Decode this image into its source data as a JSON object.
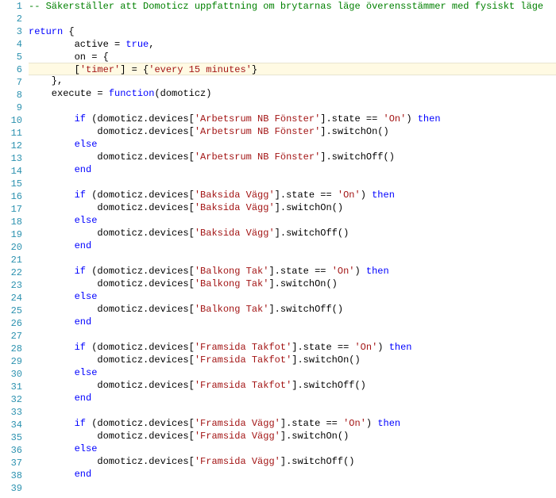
{
  "lines": [
    {
      "num": 1,
      "highlighted": false,
      "tokens": [
        {
          "t": "-- Säkerställer att Domoticz uppfattning om brytarnas läge överensstämmer med fysiskt läge",
          "c": "comment"
        }
      ]
    },
    {
      "num": 2,
      "highlighted": false,
      "tokens": []
    },
    {
      "num": 3,
      "highlighted": false,
      "tokens": [
        {
          "t": "return",
          "c": "keyword"
        },
        {
          "t": " {",
          "c": "punct"
        }
      ]
    },
    {
      "num": 4,
      "highlighted": false,
      "tokens": [
        {
          "t": "        active = ",
          "c": "ident"
        },
        {
          "t": "true",
          "c": "keyword"
        },
        {
          "t": ",",
          "c": "punct"
        }
      ]
    },
    {
      "num": 5,
      "highlighted": false,
      "tokens": [
        {
          "t": "        on = {",
          "c": "ident"
        }
      ]
    },
    {
      "num": 6,
      "highlighted": true,
      "tokens": [
        {
          "t": "        [",
          "c": "punct"
        },
        {
          "t": "'timer'",
          "c": "string"
        },
        {
          "t": "] = {",
          "c": "punct"
        },
        {
          "t": "'every 15 minutes'",
          "c": "string"
        },
        {
          "t": "}",
          "c": "punct"
        }
      ]
    },
    {
      "num": 7,
      "highlighted": false,
      "tokens": [
        {
          "t": "    },",
          "c": "punct"
        }
      ]
    },
    {
      "num": 8,
      "highlighted": false,
      "tokens": [
        {
          "t": "    execute = ",
          "c": "ident"
        },
        {
          "t": "function",
          "c": "keyword"
        },
        {
          "t": "(domoticz)",
          "c": "punct"
        }
      ]
    },
    {
      "num": 9,
      "highlighted": false,
      "tokens": []
    },
    {
      "num": 10,
      "highlighted": false,
      "tokens": [
        {
          "t": "        ",
          "c": "ident"
        },
        {
          "t": "if",
          "c": "keyword"
        },
        {
          "t": " (domoticz.devices[",
          "c": "ident"
        },
        {
          "t": "'Arbetsrum NB Fönster'",
          "c": "string"
        },
        {
          "t": "].state == ",
          "c": "ident"
        },
        {
          "t": "'On'",
          "c": "string"
        },
        {
          "t": ") ",
          "c": "ident"
        },
        {
          "t": "then",
          "c": "keyword"
        }
      ]
    },
    {
      "num": 11,
      "highlighted": false,
      "tokens": [
        {
          "t": "            domoticz.devices[",
          "c": "ident"
        },
        {
          "t": "'Arbetsrum NB Fönster'",
          "c": "string"
        },
        {
          "t": "].switchOn()",
          "c": "ident"
        }
      ]
    },
    {
      "num": 12,
      "highlighted": false,
      "tokens": [
        {
          "t": "        ",
          "c": "ident"
        },
        {
          "t": "else",
          "c": "keyword"
        }
      ]
    },
    {
      "num": 13,
      "highlighted": false,
      "tokens": [
        {
          "t": "            domoticz.devices[",
          "c": "ident"
        },
        {
          "t": "'Arbetsrum NB Fönster'",
          "c": "string"
        },
        {
          "t": "].switchOff()",
          "c": "ident"
        }
      ]
    },
    {
      "num": 14,
      "highlighted": false,
      "tokens": [
        {
          "t": "        ",
          "c": "ident"
        },
        {
          "t": "end",
          "c": "keyword"
        }
      ]
    },
    {
      "num": 15,
      "highlighted": false,
      "tokens": []
    },
    {
      "num": 16,
      "highlighted": false,
      "tokens": [
        {
          "t": "        ",
          "c": "ident"
        },
        {
          "t": "if",
          "c": "keyword"
        },
        {
          "t": " (domoticz.devices[",
          "c": "ident"
        },
        {
          "t": "'Baksida Vägg'",
          "c": "string"
        },
        {
          "t": "].state == ",
          "c": "ident"
        },
        {
          "t": "'On'",
          "c": "string"
        },
        {
          "t": ") ",
          "c": "ident"
        },
        {
          "t": "then",
          "c": "keyword"
        }
      ]
    },
    {
      "num": 17,
      "highlighted": false,
      "tokens": [
        {
          "t": "            domoticz.devices[",
          "c": "ident"
        },
        {
          "t": "'Baksida Vägg'",
          "c": "string"
        },
        {
          "t": "].switchOn()",
          "c": "ident"
        }
      ]
    },
    {
      "num": 18,
      "highlighted": false,
      "tokens": [
        {
          "t": "        ",
          "c": "ident"
        },
        {
          "t": "else",
          "c": "keyword"
        }
      ]
    },
    {
      "num": 19,
      "highlighted": false,
      "tokens": [
        {
          "t": "            domoticz.devices[",
          "c": "ident"
        },
        {
          "t": "'Baksida Vägg'",
          "c": "string"
        },
        {
          "t": "].switchOff()",
          "c": "ident"
        }
      ]
    },
    {
      "num": 20,
      "highlighted": false,
      "tokens": [
        {
          "t": "        ",
          "c": "ident"
        },
        {
          "t": "end",
          "c": "keyword"
        }
      ]
    },
    {
      "num": 21,
      "highlighted": false,
      "tokens": []
    },
    {
      "num": 22,
      "highlighted": false,
      "tokens": [
        {
          "t": "        ",
          "c": "ident"
        },
        {
          "t": "if",
          "c": "keyword"
        },
        {
          "t": " (domoticz.devices[",
          "c": "ident"
        },
        {
          "t": "'Balkong Tak'",
          "c": "string"
        },
        {
          "t": "].state == ",
          "c": "ident"
        },
        {
          "t": "'On'",
          "c": "string"
        },
        {
          "t": ") ",
          "c": "ident"
        },
        {
          "t": "then",
          "c": "keyword"
        }
      ]
    },
    {
      "num": 23,
      "highlighted": false,
      "tokens": [
        {
          "t": "            domoticz.devices[",
          "c": "ident"
        },
        {
          "t": "'Balkong Tak'",
          "c": "string"
        },
        {
          "t": "].switchOn()",
          "c": "ident"
        }
      ]
    },
    {
      "num": 24,
      "highlighted": false,
      "tokens": [
        {
          "t": "        ",
          "c": "ident"
        },
        {
          "t": "else",
          "c": "keyword"
        }
      ]
    },
    {
      "num": 25,
      "highlighted": false,
      "tokens": [
        {
          "t": "            domoticz.devices[",
          "c": "ident"
        },
        {
          "t": "'Balkong Tak'",
          "c": "string"
        },
        {
          "t": "].switchOff()",
          "c": "ident"
        }
      ]
    },
    {
      "num": 26,
      "highlighted": false,
      "tokens": [
        {
          "t": "        ",
          "c": "ident"
        },
        {
          "t": "end",
          "c": "keyword"
        }
      ]
    },
    {
      "num": 27,
      "highlighted": false,
      "tokens": []
    },
    {
      "num": 28,
      "highlighted": false,
      "tokens": [
        {
          "t": "        ",
          "c": "ident"
        },
        {
          "t": "if",
          "c": "keyword"
        },
        {
          "t": " (domoticz.devices[",
          "c": "ident"
        },
        {
          "t": "'Framsida Takfot'",
          "c": "string"
        },
        {
          "t": "].state == ",
          "c": "ident"
        },
        {
          "t": "'On'",
          "c": "string"
        },
        {
          "t": ") ",
          "c": "ident"
        },
        {
          "t": "then",
          "c": "keyword"
        }
      ]
    },
    {
      "num": 29,
      "highlighted": false,
      "tokens": [
        {
          "t": "            domoticz.devices[",
          "c": "ident"
        },
        {
          "t": "'Framsida Takfot'",
          "c": "string"
        },
        {
          "t": "].switchOn()",
          "c": "ident"
        }
      ]
    },
    {
      "num": 30,
      "highlighted": false,
      "tokens": [
        {
          "t": "        ",
          "c": "ident"
        },
        {
          "t": "else",
          "c": "keyword"
        }
      ]
    },
    {
      "num": 31,
      "highlighted": false,
      "tokens": [
        {
          "t": "            domoticz.devices[",
          "c": "ident"
        },
        {
          "t": "'Framsida Takfot'",
          "c": "string"
        },
        {
          "t": "].switchOff()",
          "c": "ident"
        }
      ]
    },
    {
      "num": 32,
      "highlighted": false,
      "tokens": [
        {
          "t": "        ",
          "c": "ident"
        },
        {
          "t": "end",
          "c": "keyword"
        }
      ]
    },
    {
      "num": 33,
      "highlighted": false,
      "tokens": []
    },
    {
      "num": 34,
      "highlighted": false,
      "tokens": [
        {
          "t": "        ",
          "c": "ident"
        },
        {
          "t": "if",
          "c": "keyword"
        },
        {
          "t": " (domoticz.devices[",
          "c": "ident"
        },
        {
          "t": "'Framsida Vägg'",
          "c": "string"
        },
        {
          "t": "].state == ",
          "c": "ident"
        },
        {
          "t": "'On'",
          "c": "string"
        },
        {
          "t": ") ",
          "c": "ident"
        },
        {
          "t": "then",
          "c": "keyword"
        }
      ]
    },
    {
      "num": 35,
      "highlighted": false,
      "tokens": [
        {
          "t": "            domoticz.devices[",
          "c": "ident"
        },
        {
          "t": "'Framsida Vägg'",
          "c": "string"
        },
        {
          "t": "].switchOn()",
          "c": "ident"
        }
      ]
    },
    {
      "num": 36,
      "highlighted": false,
      "tokens": [
        {
          "t": "        ",
          "c": "ident"
        },
        {
          "t": "else",
          "c": "keyword"
        }
      ]
    },
    {
      "num": 37,
      "highlighted": false,
      "tokens": [
        {
          "t": "            domoticz.devices[",
          "c": "ident"
        },
        {
          "t": "'Framsida Vägg'",
          "c": "string"
        },
        {
          "t": "].switchOff()",
          "c": "ident"
        }
      ]
    },
    {
      "num": 38,
      "highlighted": false,
      "tokens": [
        {
          "t": "        ",
          "c": "ident"
        },
        {
          "t": "end",
          "c": "keyword"
        }
      ]
    },
    {
      "num": 39,
      "highlighted": false,
      "tokens": []
    }
  ]
}
